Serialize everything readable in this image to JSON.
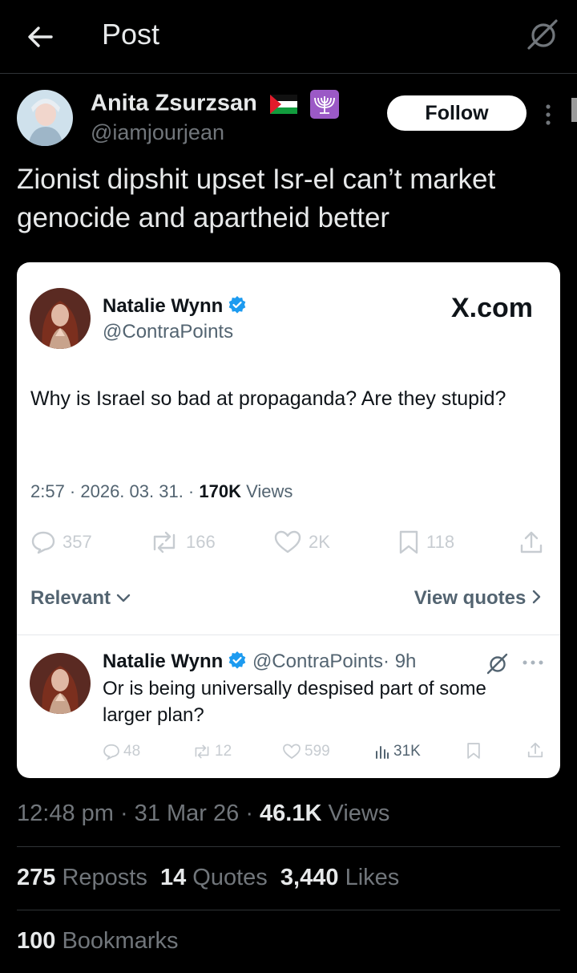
{
  "header": {
    "title": "Post"
  },
  "post": {
    "author_name": "Anita Zsurzsan",
    "author_handle": "@iamjourjean",
    "follow_label": "Follow",
    "text": "Zionist dipshit upset Isr-el can’t market genocide and apartheid better"
  },
  "embed": {
    "source": "X.com",
    "author_name": "Natalie Wynn",
    "author_handle": "@ContraPoints",
    "text": "Why is Israel so bad at propaganda? Are they stupid?",
    "time": "2:57 · 2026. 03. 31. ·",
    "views_count": "170K",
    "views_label": "Views",
    "actions": {
      "replies": "357",
      "reposts": "166",
      "likes": "2K",
      "bookmarks": "118"
    },
    "sort_label": "Relevant",
    "view_quotes_label": "View quotes",
    "reply": {
      "author_name": "Natalie Wynn",
      "author_handle": "@ContraPoints",
      "age": "· 9h",
      "text": "Or is being universally despised part of some larger plan?",
      "replies": "48",
      "reposts": "12",
      "likes": "599",
      "views": "31K"
    }
  },
  "footer": {
    "timestamp": "12:48 pm · 31 Mar 26 ·",
    "views_count": "46.1K",
    "views_label": "Views",
    "reposts_count": "275",
    "reposts_label": "Reposts",
    "quotes_count": "14",
    "quotes_label": "Quotes",
    "likes_count": "3,440",
    "likes_label": "Likes",
    "bookmarks_count": "100",
    "bookmarks_label": "Bookmarks"
  },
  "colors": {
    "background": "#000000",
    "muted": "#71767b",
    "verified": "#1d9bf0"
  }
}
